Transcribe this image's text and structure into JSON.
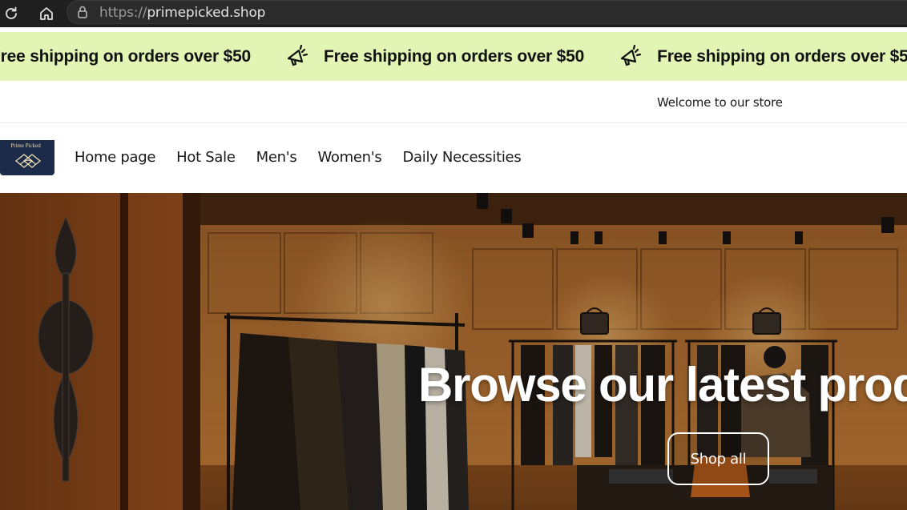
{
  "browser": {
    "url_scheme": "https://",
    "url_host": "primepicked.shop"
  },
  "announcement": {
    "items": [
      "Free shipping on orders over $50",
      "Free shipping on orders over $50",
      "Free shipping on orders over $50"
    ],
    "icon": "megaphone-icon",
    "background": "#e2f5b5"
  },
  "welcome": {
    "text": "Welcome to our store"
  },
  "header": {
    "logo_text": "Prime Picked",
    "nav": [
      {
        "label": "Home page"
      },
      {
        "label": "Hot Sale"
      },
      {
        "label": "Men's"
      },
      {
        "label": "Women's"
      },
      {
        "label": "Daily Necessities"
      }
    ]
  },
  "hero": {
    "heading": "Browse our latest products",
    "button_label": "Shop all"
  }
}
